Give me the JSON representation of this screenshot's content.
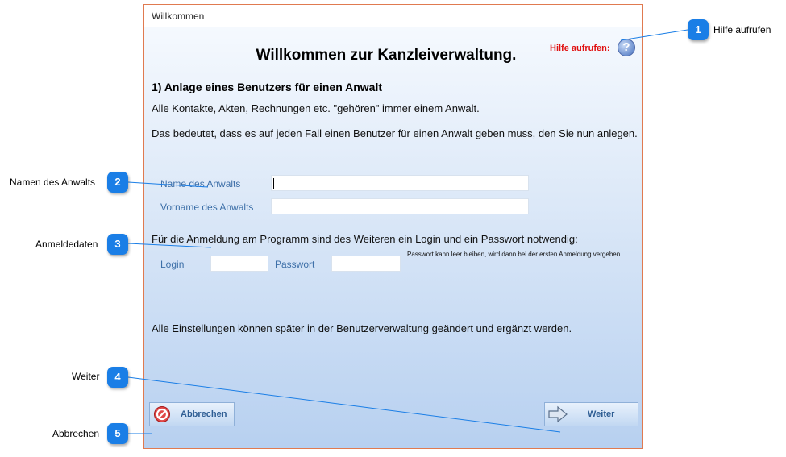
{
  "window": {
    "title": "Willkommen"
  },
  "main": {
    "title": "Willkommen zur Kanzleiverwaltung.",
    "help_label": "Hilfe aufrufen:",
    "help_icon": "help-question-icon",
    "section_heading": "1) Anlage eines Benutzers für einen Anwalt",
    "intro_1": "Alle Kontakte, Akten, Rechnungen etc. \"gehören\" immer einem Anwalt.",
    "intro_2": "Das bedeutet, dass es auf jeden Fall einen Benutzer für einen Anwalt geben muss, den Sie nun anlegen.",
    "name_label": "Name des Anwalts",
    "name_value": "",
    "firstname_label": "Vorname des Anwalts",
    "firstname_value": "",
    "login_intro": "Für die Anmeldung am Programm sind des Weiteren ein Login und ein Passwort notwendig:",
    "login_label": "Login",
    "login_value": "",
    "password_label": "Passwort",
    "password_value": "",
    "password_note": "Passwort kann leer bleiben, wird dann bei der ersten Anmeldung vergeben.",
    "footer_text": "Alle Einstellungen können später in der Benutzerverwaltung geändert und ergänzt werden."
  },
  "buttons": {
    "cancel_label": "Abbrechen",
    "cancel_icon": "no-entry-icon",
    "next_label": "Weiter",
    "next_icon": "arrow-right-icon"
  },
  "callouts": [
    {
      "number": "1",
      "label": "Hilfe aufrufen"
    },
    {
      "number": "2",
      "label": "Namen des Anwalts"
    },
    {
      "number": "3",
      "label": "Anmeldedaten"
    },
    {
      "number": "4",
      "label": "Weiter"
    },
    {
      "number": "5",
      "label": "Abbrechen"
    }
  ],
  "colors": {
    "badge": "#1a7ee6",
    "callout_line": "#1a7ee6",
    "help_label": "#e01010",
    "window_border": "#e07a50"
  }
}
